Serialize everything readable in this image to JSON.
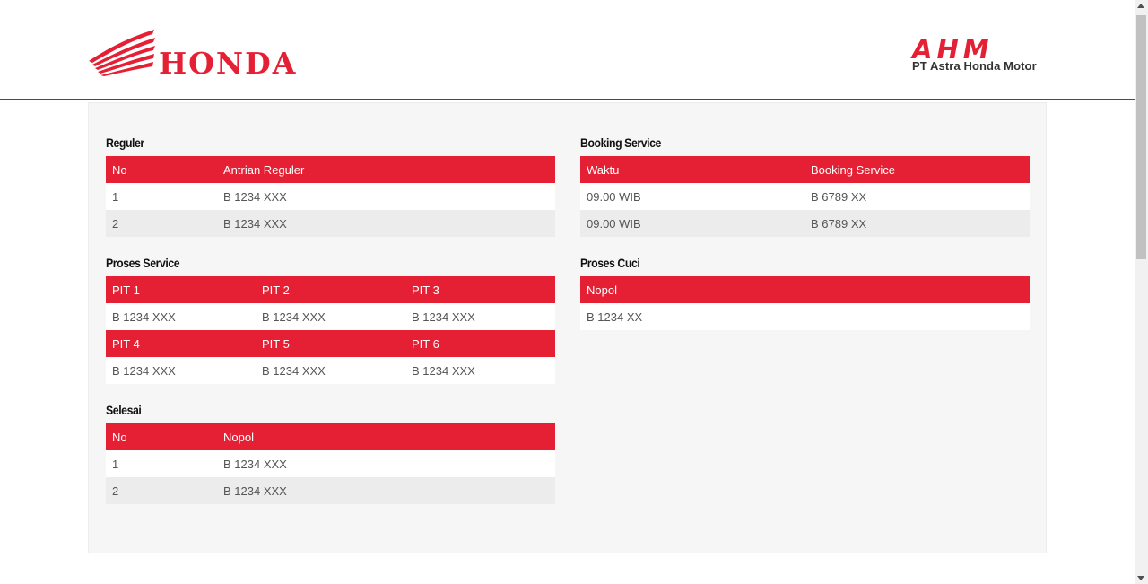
{
  "header": {
    "brand_left": "HONDA",
    "brand_right": "AHM",
    "brand_right_sub": "PT Astra Honda Motor"
  },
  "colors": {
    "brand_red": "#e62034",
    "panel_bg": "#f6f6f6"
  },
  "reguler": {
    "title": "Reguler",
    "headers": [
      "No",
      "Antrian Reguler"
    ],
    "rows": [
      [
        "1",
        "B 1234 XXX"
      ],
      [
        "2",
        "B 1234 XXX"
      ]
    ]
  },
  "proses_service": {
    "title": "Proses Service",
    "headers_1": [
      "PIT 1",
      "PIT 2",
      "PIT 3"
    ],
    "row_1": [
      "B 1234 XXX",
      "B 1234 XXX",
      "B 1234 XXX"
    ],
    "headers_2": [
      "PIT 4",
      "PIT 5",
      "PIT 6"
    ],
    "row_2": [
      "B 1234 XXX",
      "B 1234 XXX",
      "B 1234 XXX"
    ]
  },
  "selesai": {
    "title": "Selesai",
    "headers": [
      "No",
      "Nopol"
    ],
    "rows": [
      [
        "1",
        "B 1234 XXX"
      ],
      [
        "2",
        "B 1234 XXX"
      ]
    ]
  },
  "booking_service": {
    "title": "Booking Service",
    "headers": [
      "Waktu",
      "Booking Service"
    ],
    "rows": [
      [
        "09.00 WIB",
        "B 6789 XX"
      ],
      [
        "09.00 WIB",
        "B 6789 XX"
      ]
    ]
  },
  "proses_cuci": {
    "title": "Proses Cuci",
    "headers": [
      "Nopol"
    ],
    "rows": [
      [
        "B 1234 XX"
      ]
    ]
  }
}
